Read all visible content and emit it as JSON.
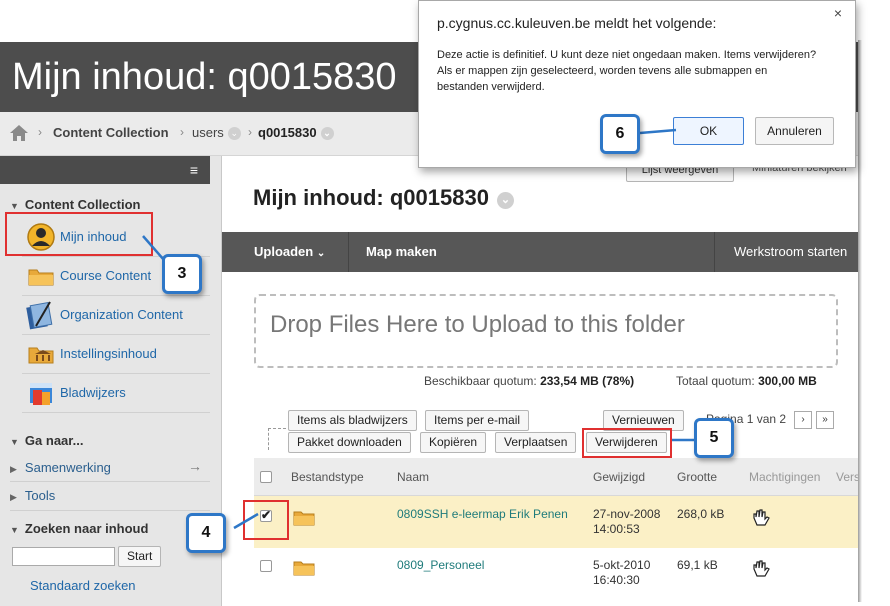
{
  "banner": {
    "title": "Mijn inhoud: q0015830"
  },
  "breadcrumb": {
    "items": [
      "Content Collection",
      "users",
      "q0015830"
    ]
  },
  "sidebar": {
    "section_title": "Content Collection",
    "items": [
      {
        "label": "Mijn inhoud",
        "icon": "user-avatar-icon"
      },
      {
        "label": "Course Content",
        "icon": "folder-icon"
      },
      {
        "label": "Organization Content",
        "icon": "notebook-icon"
      },
      {
        "label": "Instellingsinhoud",
        "icon": "institution-folder-icon"
      },
      {
        "label": "Bladwijzers",
        "icon": "bookmarks-icon"
      }
    ],
    "goto_title": "Ga naar...",
    "goto_items": [
      "Samenwerking",
      "Tools"
    ],
    "search_title": "Zoeken naar inhoud",
    "search_button": "Start",
    "search_value": "",
    "standard_search": "Standaard zoeken"
  },
  "main": {
    "title": "Mijn inhoud: q0015830",
    "peek_buttons": [
      "Lijst weergeven",
      "Miniaturen bekijken"
    ],
    "toolbar": {
      "upload": "Uploaden",
      "make_folder": "Map maken",
      "workflow": "Werkstroom starten"
    },
    "dropzone": "Drop Files Here to Upload to this folder",
    "quota": {
      "available_label": "Beschikbaar quotum:",
      "available_value": "233,54 MB (78%)",
      "total_label": "Totaal quotum:",
      "total_value": "300,00 MB"
    },
    "actions_row1": [
      "Items als bladwijzers",
      "Items per e-mail"
    ],
    "actions_row2": [
      "Pakket downloaden",
      "Kopiëren",
      "Verplaatsen",
      "Verwijderen"
    ],
    "refresh": "Vernieuwen",
    "pager": "Pagina 1 van 2",
    "columns": [
      "Bestandstype",
      "Naam",
      "Gewijzigd",
      "Grootte",
      "Machtigingen",
      "Versies"
    ],
    "rows": [
      {
        "name": "0809SSH e-leermap Erik Penen",
        "date": "27-nov-2008",
        "time": "14:00:53",
        "size": "268,0 kB",
        "checked": true
      },
      {
        "name": "0809_Personeel",
        "date": "5-okt-2010",
        "time": "16:40:30",
        "size": "69,1 kB",
        "checked": false
      }
    ]
  },
  "dialog": {
    "title": "p.cygnus.cc.kuleuven.be meldt het volgende:",
    "message": "Deze actie is definitief. U kunt deze niet ongedaan maken. Items verwijderen? Als er mappen zijn geselecteerd, worden tevens alle submappen en bestanden verwijderd.",
    "ok": "OK",
    "cancel": "Annuleren",
    "close": "×"
  },
  "callouts": [
    "3",
    "4",
    "5",
    "6"
  ]
}
